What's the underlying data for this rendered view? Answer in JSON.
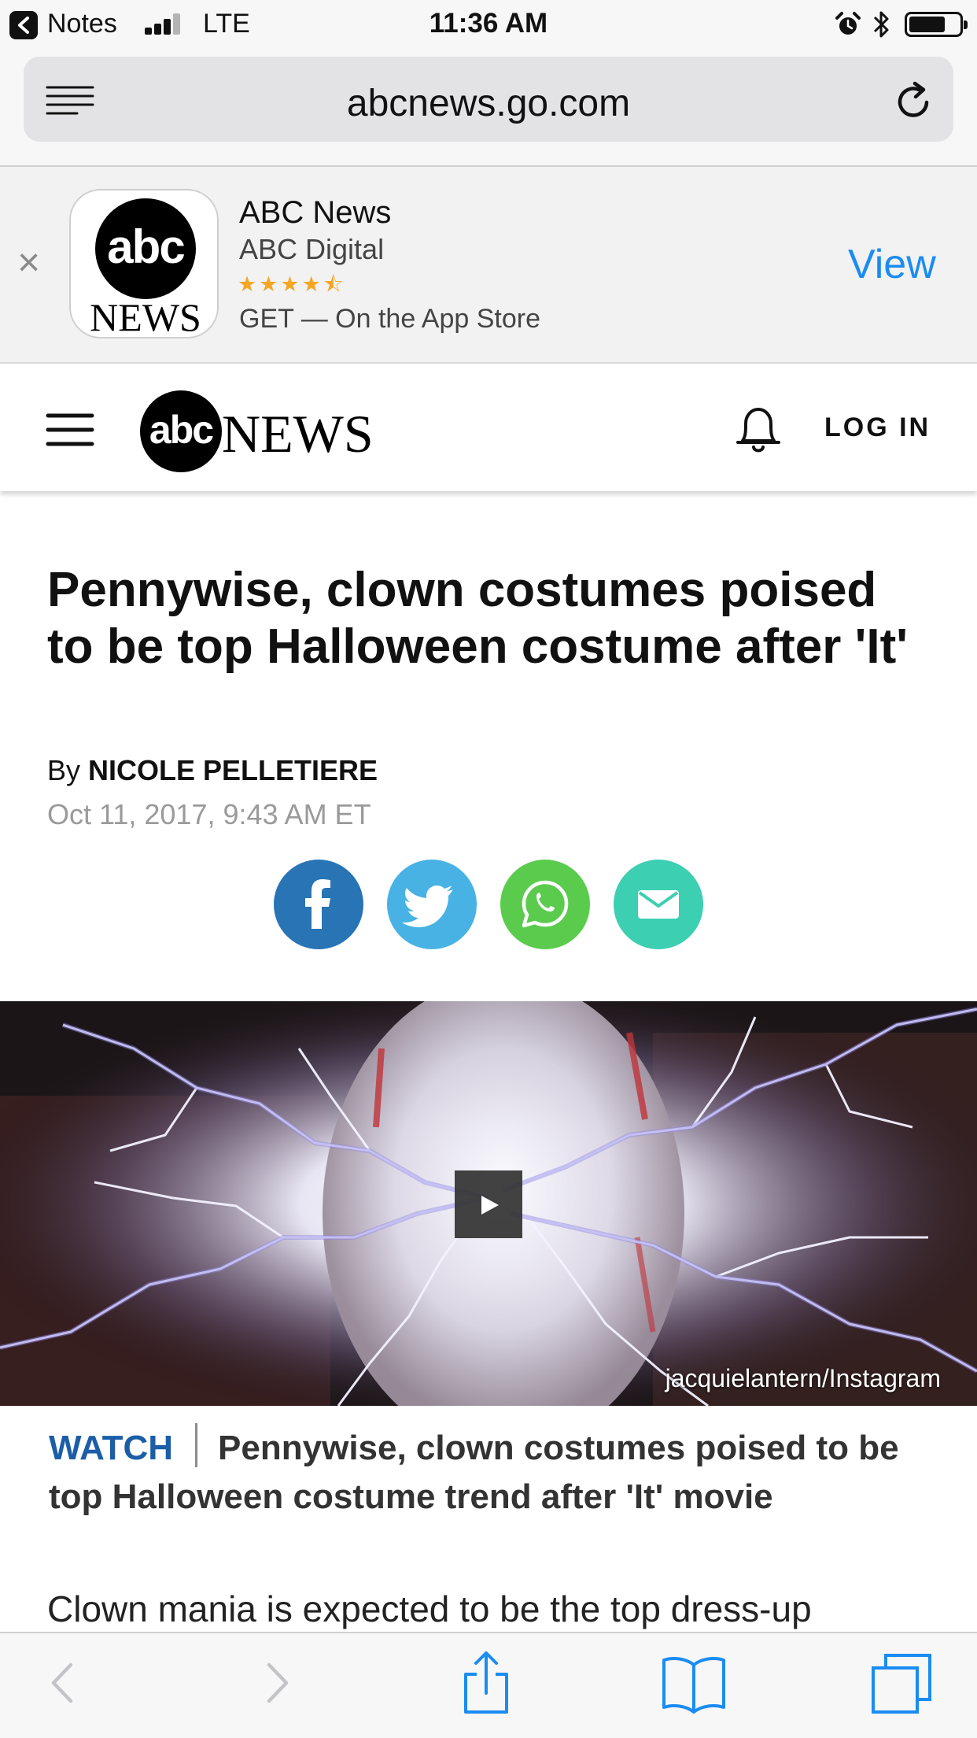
{
  "status_bar": {
    "back_app": "Notes",
    "network": "LTE",
    "time": "11:36 AM"
  },
  "browser": {
    "url": "abcnews.go.com"
  },
  "app_banner": {
    "icon_globe_text": "abc",
    "icon_word": "NEWS",
    "app_name": "ABC News",
    "publisher": "ABC Digital",
    "rating_stars": "★★★★⯪",
    "rating_value": 4.5,
    "get_text": "GET — On the App Store",
    "view_label": "View"
  },
  "site_header": {
    "logo_globe": "abc",
    "logo_word": "NEWS",
    "login_label": "LOG IN"
  },
  "article": {
    "headline": "Pennywise, clown costumes poised to be top Halloween costume after 'It'",
    "byline_prefix": "By",
    "author": "NICOLE PELLETIERE",
    "date": "Oct 11, 2017, 9:43 AM ET",
    "video_credit": "jacquielantern/Instagram",
    "watch_label": "WATCH",
    "video_caption": "Pennywise, clown costumes poised to be top Halloween costume trend after 'It' movie",
    "body_start": "Clown mania is expected to be the top dress-up"
  },
  "colors": {
    "facebook": "#2874b5",
    "twitter": "#48b2e4",
    "whatsapp": "#5bcb4e",
    "email": "#3ccfb2",
    "link_blue": "#1a8cf2",
    "watch_blue": "#1b5ea7",
    "star_orange": "#f5a623"
  },
  "icons": {
    "back": "chevron-left-icon",
    "signal": "signal-bars-icon",
    "alarm": "alarm-clock-icon",
    "bluetooth": "bluetooth-icon",
    "battery": "battery-icon",
    "reader": "reader-view-icon",
    "reload": "reload-icon",
    "close": "close-icon",
    "menu": "hamburger-menu-icon",
    "notifications": "bell-icon",
    "share_facebook": "facebook-icon",
    "share_twitter": "twitter-icon",
    "share_whatsapp": "whatsapp-icon",
    "share_email": "email-icon",
    "play": "play-icon",
    "toolbar": [
      "chevron-left-icon",
      "chevron-right-icon",
      "share-icon",
      "bookmarks-icon",
      "tabs-icon"
    ]
  }
}
